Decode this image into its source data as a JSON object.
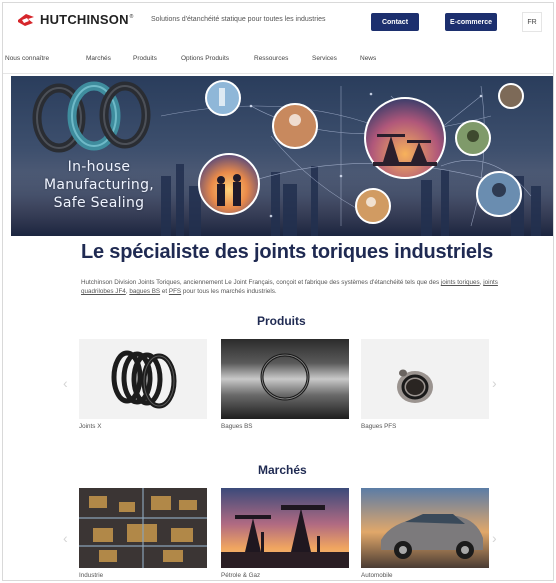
{
  "header": {
    "logo_text": "HUTCHINSON",
    "logo_reg": "®",
    "tagline": "Solutions d'étanchéité statique pour toutes les industries",
    "contact_label": "Contact",
    "ecommerce_label": "E-commerce",
    "lang_label": "FR"
  },
  "nav": {
    "items": [
      "Nous connaître",
      "Marchés",
      "Produits",
      "Options Produits",
      "Ressources",
      "Services",
      "News"
    ]
  },
  "hero": {
    "line1": "In-house",
    "line2": "Manufacturing,",
    "line3": "Safe Sealing"
  },
  "intro": {
    "title": "Le spécialiste des joints toriques industriels",
    "text_a": "Hutchinson Division Joints Toriques, anciennement Le Joint Français, conçoit et fabrique des systèmes d'étanchéité tels que des ",
    "link1": "joints toriques",
    "sep1": ", ",
    "link2": "joints quadrilobes JF4",
    "sep2": ", ",
    "link3": "bagues BS",
    "sep3": " et ",
    "link4": "PFS",
    "text_b": " pour tous les marchés industriels."
  },
  "produits": {
    "title": "Produits",
    "items": [
      "Joints X",
      "Bagues BS",
      "Bagues PFS"
    ]
  },
  "marches": {
    "title": "Marchés",
    "items": [
      "Industrie",
      "Pétrole & Gaz",
      "Automobile"
    ]
  },
  "colors": {
    "brand_navy": "#1c2f6e",
    "logo_red": "#d6262b",
    "title_navy": "#1f2a52"
  }
}
